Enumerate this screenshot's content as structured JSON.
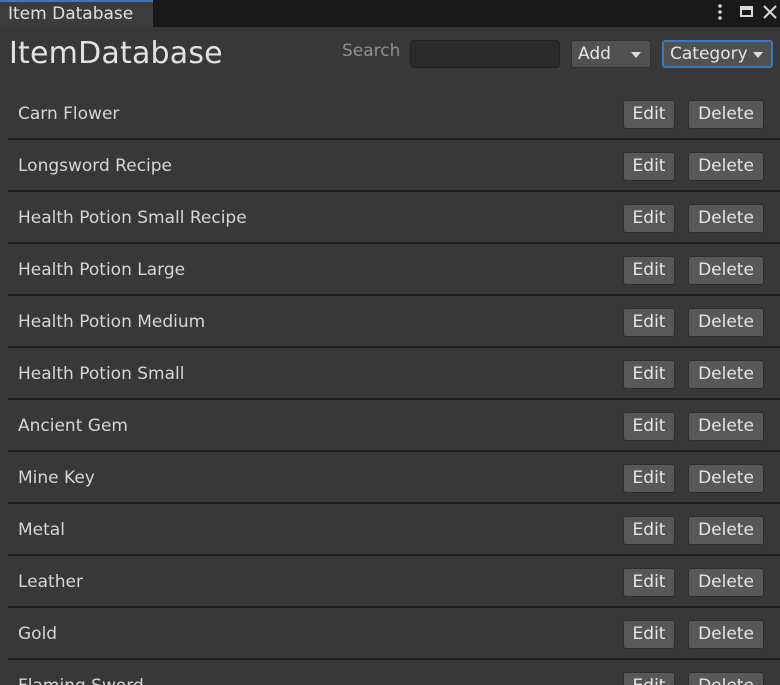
{
  "window": {
    "tab_title": "Item Database",
    "menu_icon": "vertical-ellipsis",
    "maximize_icon": "maximize-window",
    "close_icon": "close-x"
  },
  "header": {
    "title": "ItemDatabase",
    "search_label": "Search",
    "search_value": "",
    "add_dropdown": {
      "label": "Add"
    },
    "category_dropdown": {
      "label": "Category"
    }
  },
  "items": [
    {
      "name": "Carn Flower",
      "edit_label": "Edit",
      "delete_label": "Delete"
    },
    {
      "name": "Longsword Recipe",
      "edit_label": "Edit",
      "delete_label": "Delete"
    },
    {
      "name": "Health Potion Small Recipe",
      "edit_label": "Edit",
      "delete_label": "Delete"
    },
    {
      "name": "Health Potion Large",
      "edit_label": "Edit",
      "delete_label": "Delete"
    },
    {
      "name": "Health Potion Medium",
      "edit_label": "Edit",
      "delete_label": "Delete"
    },
    {
      "name": "Health Potion Small",
      "edit_label": "Edit",
      "delete_label": "Delete"
    },
    {
      "name": "Ancient Gem",
      "edit_label": "Edit",
      "delete_label": "Delete"
    },
    {
      "name": "Mine Key",
      "edit_label": "Edit",
      "delete_label": "Delete"
    },
    {
      "name": "Metal",
      "edit_label": "Edit",
      "delete_label": "Delete"
    },
    {
      "name": "Leather",
      "edit_label": "Edit",
      "delete_label": "Delete"
    },
    {
      "name": "Gold",
      "edit_label": "Edit",
      "delete_label": "Delete"
    },
    {
      "name": "Flaming Sword",
      "edit_label": "Edit",
      "delete_label": "Delete"
    }
  ],
  "colors": {
    "background": "#383838",
    "tab_accent": "#3a79bb",
    "button": "#585858",
    "row_divider": "#1f1f1f"
  }
}
